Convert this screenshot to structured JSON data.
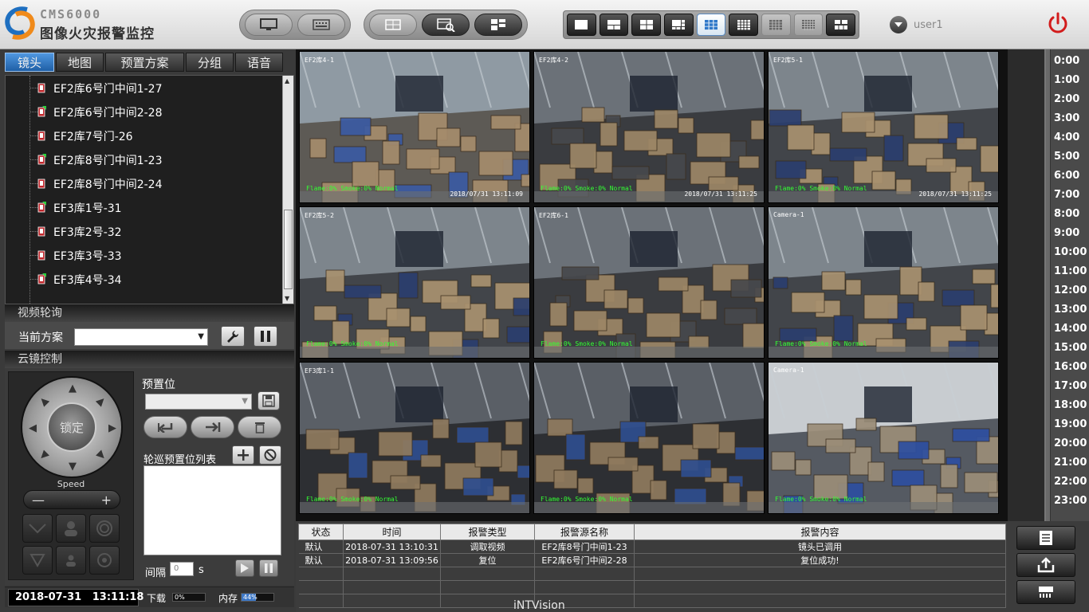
{
  "app": {
    "title_en": "CMS6000",
    "title_cn": "图像火灾报警监控"
  },
  "user": {
    "name": "user1"
  },
  "toolbar": {
    "left_pills": [
      {
        "icon": "monitor-icon"
      },
      {
        "icon": "keyboard-icon"
      }
    ],
    "mid_pills": [
      {
        "icon": "window-icon"
      },
      {
        "icon": "image-search-icon"
      },
      {
        "icon": "device-tree-icon"
      }
    ],
    "layouts": [
      "1x1",
      "1+2",
      "2x2",
      "1+5",
      "3x3",
      "4x4-a",
      "4x4-b",
      "5x5",
      "custom"
    ],
    "active_layout": "3x3"
  },
  "left_tabs": [
    "镜头",
    "地图",
    "预置方案",
    "分组",
    "语音"
  ],
  "camera_tree": [
    {
      "label": "EF2库6号门中间1-27",
      "online": false
    },
    {
      "label": "EF2库6号门中间2-28",
      "online": true
    },
    {
      "label": "EF2库7号门-26",
      "online": false
    },
    {
      "label": "EF2库8号门中间1-23",
      "online": true
    },
    {
      "label": "EF2库8号门中间2-24",
      "online": false
    },
    {
      "label": "EF3库1号-31",
      "online": true
    },
    {
      "label": "EF3库2号-32",
      "online": false
    },
    {
      "label": "EF3库3号-33",
      "online": false
    },
    {
      "label": "EF3库4号-34",
      "online": true
    }
  ],
  "video_tour": {
    "title": "视频轮询",
    "current_label": "当前方案",
    "current_value": ""
  },
  "ptz": {
    "title": "云镜控制",
    "lock_label": "锁定",
    "speed_label": "Speed",
    "preset_label": "预置位",
    "cruise_label": "轮巡预置位列表",
    "interval_label": "间隔",
    "interval_value": "0",
    "interval_unit": "s"
  },
  "status": {
    "date": "2018-07-31",
    "time": "13:11:18",
    "download_label": "下载",
    "download_value": "0%",
    "download_fraction": 0.0,
    "memory_label": "内存",
    "memory_value": "44%",
    "memory_fraction": 0.44
  },
  "cameras": [
    {
      "name": "EF2库4-1",
      "status": "Flame:0% Smoke:0% Normal",
      "time": "2018/07/31 13:11:09",
      "tone": "warehouse-bright"
    },
    {
      "name": "EF2库4-2",
      "status": "Flame:0% Smoke:0% Normal",
      "time": "2018/07/31 13:11:25",
      "tone": "warehouse-aisle"
    },
    {
      "name": "EF2库5-1",
      "status": "Flame:0% Smoke:0% Normal",
      "time": "2018/07/31 13:11:25",
      "tone": "warehouse-crates"
    },
    {
      "name": "EF2库5-2",
      "status": "Flame:0% Smoke:0% Normal",
      "time": "",
      "tone": "warehouse-crates"
    },
    {
      "name": "EF2库6-1",
      "status": "Flame:0% Smoke:0% Normal",
      "time": "",
      "tone": "warehouse-aisle"
    },
    {
      "name": "Camera-1",
      "status": "Flame:0% Smoke:0% Normal",
      "time": "",
      "tone": "warehouse-crates"
    },
    {
      "name": "EF3库1-1",
      "status": "Flame:0% Smoke:0% Normal",
      "time": "",
      "tone": "warehouse-racks"
    },
    {
      "name": "",
      "status": "Flame:0% Smoke:0% Normal",
      "time": "",
      "tone": "warehouse-racks"
    },
    {
      "name": "Camera-1",
      "status": "Flame:0% Smoke:0% Normal",
      "time": "",
      "tone": "warehouse-racks-blue"
    }
  ],
  "timeline_hours": [
    "0:00",
    "1:00",
    "2:00",
    "3:00",
    "4:00",
    "5:00",
    "6:00",
    "7:00",
    "8:00",
    "9:00",
    "10:00",
    "11:00",
    "12:00",
    "13:00",
    "14:00",
    "15:00",
    "16:00",
    "17:00",
    "18:00",
    "19:00",
    "20:00",
    "21:00",
    "22:00",
    "23:00"
  ],
  "alarm_table": {
    "headers": [
      "状态",
      "时间",
      "报警类型",
      "报警源名称",
      "报警内容"
    ],
    "rows": [
      [
        "默认",
        "2018-07-31 13:10:31",
        "调取视频",
        "EF2库8号门中间1-23",
        "镜头已调用"
      ],
      [
        "默认",
        "2018-07-31 13:09:56",
        "复位",
        "EF2库6号门中间2-28",
        "复位成功!"
      ],
      [
        "",
        "",
        "",
        "",
        ""
      ],
      [
        "",
        "",
        "",
        "",
        ""
      ],
      [
        "",
        "",
        "",
        "",
        ""
      ]
    ]
  },
  "watermark": "iNTVision",
  "right_buttons": [
    {
      "icon": "document-icon"
    },
    {
      "icon": "export-icon"
    },
    {
      "icon": "network-icon"
    }
  ],
  "colors": {
    "accent_blue": "#2f78c9",
    "power_red": "#d21c1c",
    "osd_green": "#33ff33",
    "panel": "#3a3a3a"
  }
}
